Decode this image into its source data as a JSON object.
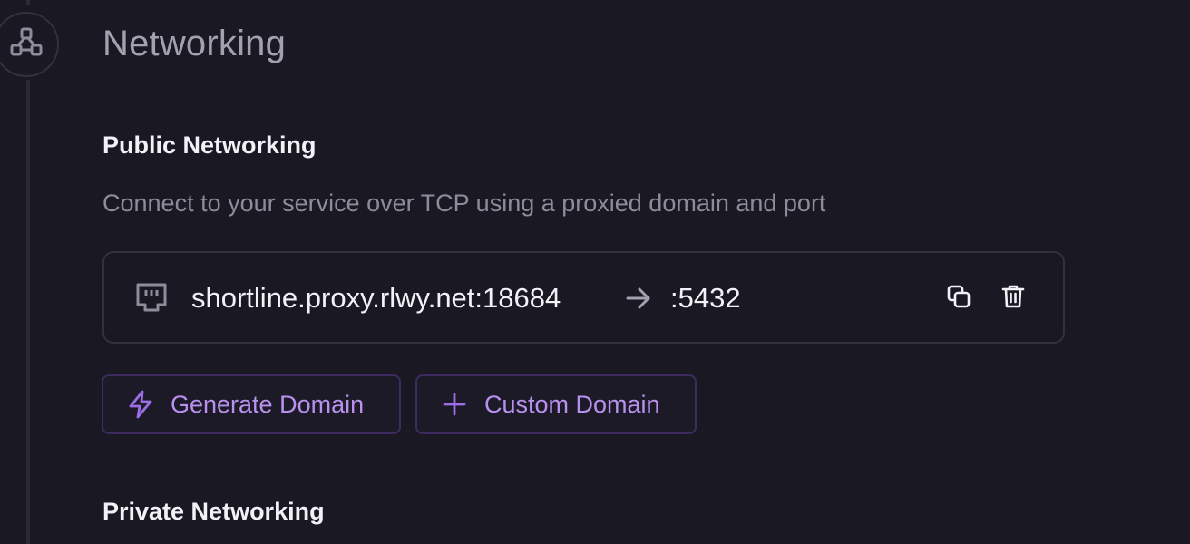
{
  "section": {
    "title": "Networking",
    "icon": "network-icon"
  },
  "public_networking": {
    "title": "Public Networking",
    "description": "Connect to your service over TCP using a proxied domain and port",
    "proxy": {
      "domain": "shortline.proxy.rlwy.net:18684",
      "port": ":5432",
      "icons": {
        "type": "ethernet-icon",
        "arrow": "arrow-right-icon",
        "copy": "copy-icon",
        "delete": "trash-icon"
      }
    },
    "buttons": {
      "generate_label": "Generate Domain",
      "generate_icon": "lightning-icon",
      "custom_label": "Custom Domain",
      "custom_icon": "plus-icon"
    }
  },
  "private_networking": {
    "title": "Private Networking"
  },
  "colors": {
    "background": "#1a1823",
    "accent": "#b891ee",
    "accent_border": "#3d2a5e",
    "card_border": "#33313c",
    "text_primary": "#f2f1f5",
    "text_muted": "#8f8c99"
  }
}
